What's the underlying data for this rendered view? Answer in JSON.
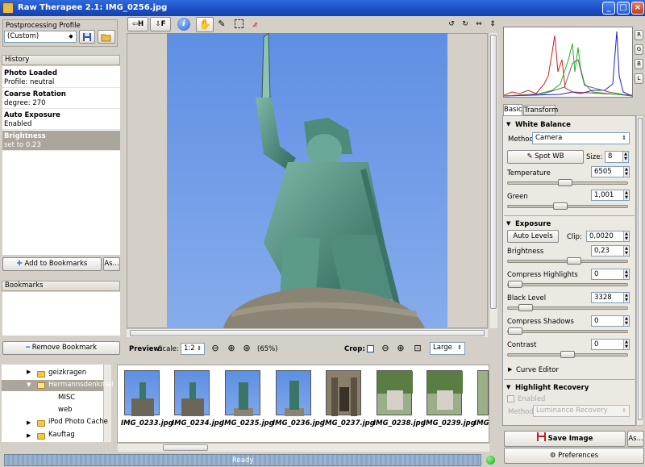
{
  "window": {
    "title": "Raw Therapee 2.1: IMG_0256.jpg",
    "buttons": [
      "_",
      "□",
      "×"
    ]
  },
  "left": {
    "profile_label": "Postprocessing Profile",
    "profile_value": "(Custom)",
    "history_header": "History",
    "history": [
      {
        "title": "Photo Loaded",
        "detail": "Profile: neutral"
      },
      {
        "title": "Coarse Rotation",
        "detail": "degree: 270"
      },
      {
        "title": "Auto Exposure",
        "detail": "Enabled"
      },
      {
        "title": "Brightness",
        "detail": "set to 0.23"
      }
    ],
    "add_bookmark": "Add to Bookmarks",
    "as_btn": "As...",
    "bookmarks_header": "Bookmarks",
    "remove_bookmark": "Remove Bookmark"
  },
  "toolbar": {
    "h_label": "H",
    "f_label": "F"
  },
  "preview": {
    "label": "Preview:",
    "scale_label": "Scale:",
    "scale_value": "1:2",
    "zoom_pct": "(65%)",
    "crop_label": "Crop:",
    "crop_size": "Large"
  },
  "tree": {
    "items": [
      "geizkragen",
      "Hermannsdenkmal",
      "MISC",
      "web",
      "iPod Photo Cache",
      "Kauftag"
    ]
  },
  "thumbnails": [
    "IMG_0233.jpg",
    "IMG_0234.jpg",
    "IMG_0235.jpg",
    "IMG_0236.jpg",
    "IMG_0237.jpg",
    "IMG_0238.jpg",
    "IMG_0239.jpg",
    "IMG_"
  ],
  "status": {
    "text": "Ready"
  },
  "right": {
    "hist_buttons": [
      "R",
      "G",
      "B",
      "L"
    ],
    "tabs": [
      "Basic",
      "Transform"
    ],
    "white_balance": {
      "title": "White Balance",
      "method_label": "Method:",
      "method_value": "Camera",
      "spot_wb": "Spot WB",
      "size_label": "Size:",
      "size_value": "8",
      "temp_label": "Temperature",
      "temp_value": "6505",
      "temp_pos": 0.48,
      "green_label": "Green",
      "green_value": "1,001",
      "green_pos": 0.43
    },
    "exposure": {
      "title": "Exposure",
      "auto_levels": "Auto Levels",
      "clip_label": "Clip:",
      "clip_value": "0,0020",
      "brightness_label": "Brightness",
      "brightness_value": "0,23",
      "brightness_pos": 0.56,
      "comp_high_label": "Compress Highlights",
      "comp_high_value": "0",
      "comp_high_pos": 0.0,
      "black_label": "Black Level",
      "black_value": "3328",
      "black_pos": 0.1,
      "comp_shadows_label": "Compress Shadows",
      "comp_shadows_value": "0",
      "comp_shadows_pos": 0.0,
      "contrast_label": "Contrast",
      "contrast_value": "0",
      "contrast_pos": 0.5,
      "curve_editor": "Curve Editor"
    },
    "highlight": {
      "title": "Highlight Recovery",
      "enabled_label": "Enabled",
      "method_label": "Method:",
      "method_value": "Luminance Recovery"
    },
    "save_image": "Save Image",
    "as_btn": "As...",
    "preferences": "Preferences"
  },
  "colors": {
    "accent": "#1b4fc4",
    "selection": "#aaa69b",
    "sky": "#5b8ee6"
  }
}
